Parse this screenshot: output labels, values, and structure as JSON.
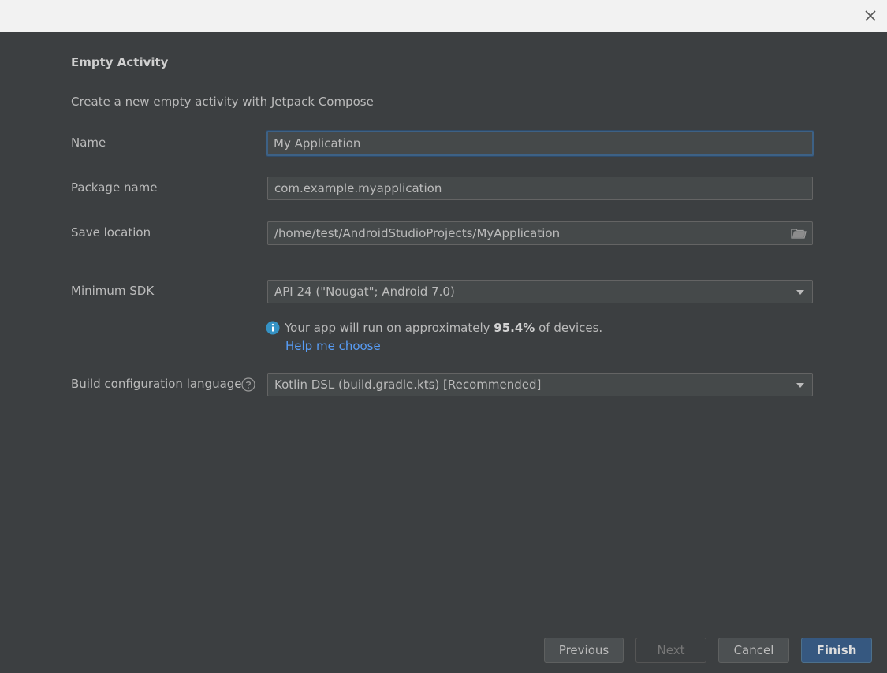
{
  "header": {
    "title": "Empty Activity",
    "description": "Create a new empty activity with Jetpack Compose"
  },
  "form": {
    "name_label": "Name",
    "name_value": "My Application",
    "package_label": "Package name",
    "package_value": "com.example.myapplication",
    "location_label": "Save location",
    "location_value": "/home/test/AndroidStudioProjects/MyApplication",
    "min_sdk_label": "Minimum SDK",
    "min_sdk_value": "API 24 (\"Nougat\"; Android 7.0)",
    "info_prefix": "Your app will run on approximately ",
    "info_percent": "95.4%",
    "info_suffix": " of devices.",
    "help_link": "Help me choose",
    "build_lang_label": "Build configuration language",
    "build_lang_value": "Kotlin DSL (build.gradle.kts) [Recommended]"
  },
  "footer": {
    "previous": "Previous",
    "next": "Next",
    "cancel": "Cancel",
    "finish": "Finish"
  },
  "icons": {
    "close": "close-icon",
    "folder": "folder-icon",
    "info": "info-icon",
    "help": "question-mark-icon",
    "dropdown": "chevron-down-icon"
  },
  "colors": {
    "background": "#3c3f41",
    "link": "#589df6",
    "primary_button": "#365880",
    "focus_border": "#3d6185"
  }
}
